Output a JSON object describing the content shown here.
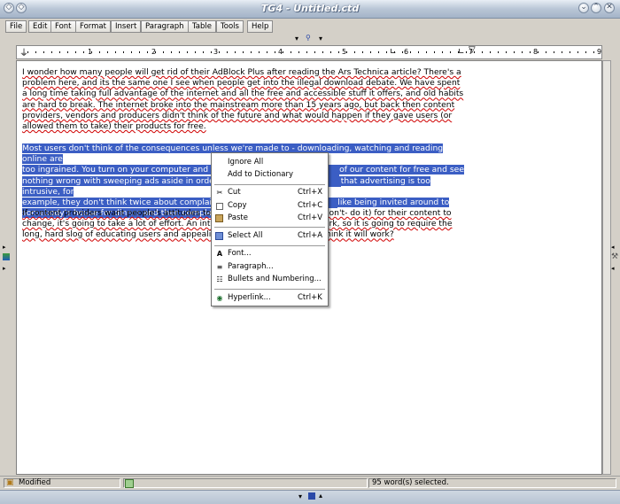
{
  "window": {
    "title": "TG4 - Untitled.ctd"
  },
  "menu": [
    {
      "label": "File"
    },
    {
      "label": "Edit"
    },
    {
      "label": "Font"
    },
    {
      "label": "Format"
    },
    {
      "label": "Insert"
    },
    {
      "label": "Paragraph"
    },
    {
      "label": "Table"
    },
    {
      "label": "Tools"
    },
    {
      "label": "Help"
    }
  ],
  "ruler": {
    "numbers": [
      "1",
      "2",
      "3",
      "4",
      "5",
      "6",
      "7",
      "8",
      "9"
    ]
  },
  "document": {
    "para1": {
      "segments": [
        "I wonder how many people will get rid of their AdBlock Plus after reading the Ars Technica article? There's a problem here, and its the same one I see when people get into the illegal download debate. We have spent a long time taking full advantage of the internet and all the free and accessible stuff it offers, and old habits are hard to break. The internet broke into the mainstream more than 15 years ago, but back then content providers, vendors and producers didn't think of the future and what would happen if they gave users (or allowed them to take) their products for free."
      ]
    },
    "para2_visible_lines": [
      "Most users don't think of the consequences unless we're made to - downloading, watching and reading online are",
      "too ingrained. You turn on your computer and the",
      "of our content for free and see",
      "nothing wrong with sweeping ads aside in order to",
      "that advertising is too intrusive, for",
      "example, they don't think twice about complainin",
      "like being invited around to",
      "somebody's house for dinner and then complainin"
    ],
    "para3_visible_lines": [
      "If content providers want people's attitudes towar",
      "r don't- do it) for their content to",
      "change, it's going to take a lot of effort. An intern",
      "rk, so it is going to require the",
      "long, hard slog of educating users and appealing",
      "hink it will work?"
    ]
  },
  "context_menu": {
    "items": [
      {
        "label": "Ignore All",
        "shortcut": "",
        "icon": ""
      },
      {
        "label": "Add to Dictionary",
        "shortcut": "",
        "icon": ""
      },
      {
        "label": "Cut",
        "shortcut": "Ctrl+X",
        "icon": "scissors-icon"
      },
      {
        "label": "Copy",
        "shortcut": "Ctrl+C",
        "icon": "copy-icon"
      },
      {
        "label": "Paste",
        "shortcut": "Ctrl+V",
        "icon": "paste-icon"
      },
      {
        "label": "Select All",
        "shortcut": "Ctrl+A",
        "icon": "select-all-icon"
      },
      {
        "label": "Font...",
        "shortcut": "",
        "icon": "font-icon"
      },
      {
        "label": "Paragraph...",
        "shortcut": "",
        "icon": "paragraph-icon"
      },
      {
        "label": "Bullets and Numbering...",
        "shortcut": "",
        "icon": "bullets-icon"
      },
      {
        "label": "Hyperlink...",
        "shortcut": "Ctrl+K",
        "icon": "hyperlink-icon"
      }
    ]
  },
  "statusbar": {
    "state": "Modified",
    "selection": "95 word(s) selected."
  },
  "colors": {
    "selection": "#3b5ec4",
    "spellcheck": "#d00000",
    "titlebar": "#b9c6d6"
  }
}
